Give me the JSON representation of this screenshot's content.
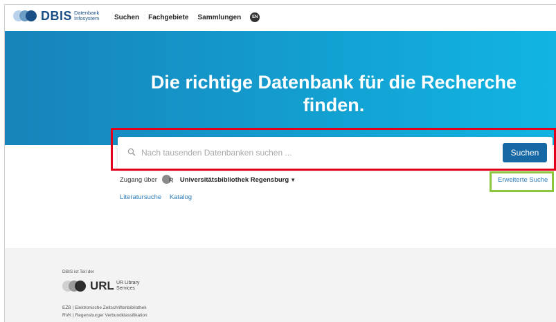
{
  "header": {
    "logo_text": "DBIS",
    "logo_sub1": "Datenbank",
    "logo_sub2": "Infosystem",
    "nav": [
      "Suchen",
      "Fachgebiete",
      "Sammlungen"
    ],
    "lang_badge": "EN"
  },
  "hero": {
    "title": "Die richtige Datenbank für die Recherche finden."
  },
  "search": {
    "placeholder": "Nach tausenden Datenbanken suchen ...",
    "value": "",
    "button_label": "Suchen",
    "icon": "search-icon"
  },
  "access": {
    "label": "Zugang über",
    "institution_icon_text": "R",
    "institution": "Universitätsbibliothek Regensburg",
    "dropdown_icon": "chevron-down-icon"
  },
  "advanced_search_label": "Erweiterte Suche",
  "links": [
    "Literatursuche",
    "Katalog"
  ],
  "footer": {
    "part_of_label": "DBIS ist Teil der",
    "url_logo_text": "URL",
    "url_sub1": "UR Library",
    "url_sub2": "Services",
    "lines": [
      "EZB | Elektronische Zeitschriftenbibliothek",
      "RVK | Regensburger Verbundklassifikation"
    ]
  },
  "colors": {
    "hero_start": "#1783bb",
    "hero_end": "#11b5e2",
    "button": "#1769a6",
    "link": "#2a7ab8",
    "highlight_red": "#e3001b",
    "highlight_green": "#8cc63f"
  }
}
